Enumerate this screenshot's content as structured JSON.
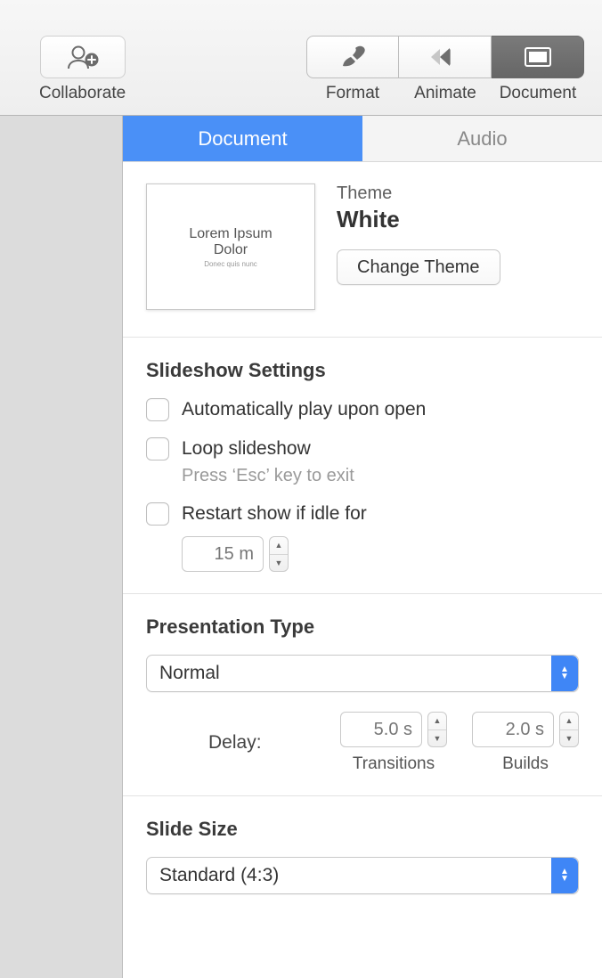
{
  "toolbar": {
    "collaborate_label": "Collaborate",
    "format_label": "Format",
    "animate_label": "Animate",
    "document_label": "Document"
  },
  "tabs": {
    "document": "Document",
    "audio": "Audio"
  },
  "theme": {
    "preview_line1": "Lorem Ipsum",
    "preview_line2": "Dolor",
    "preview_line3": "Donec quis nunc",
    "label": "Theme",
    "name": "White",
    "change_btn": "Change Theme"
  },
  "slideshow": {
    "heading": "Slideshow Settings",
    "autoplay": "Automatically play upon open",
    "loop": "Loop slideshow",
    "loop_hint": "Press ‘Esc’ key to exit",
    "restart": "Restart show if idle for",
    "restart_value": "15 m"
  },
  "presentation": {
    "heading": "Presentation Type",
    "type_value": "Normal",
    "delay_label": "Delay:",
    "transitions_value": "5.0 s",
    "transitions_label": "Transitions",
    "builds_value": "2.0 s",
    "builds_label": "Builds"
  },
  "slidesize": {
    "heading": "Slide Size",
    "value": "Standard (4:3)"
  }
}
